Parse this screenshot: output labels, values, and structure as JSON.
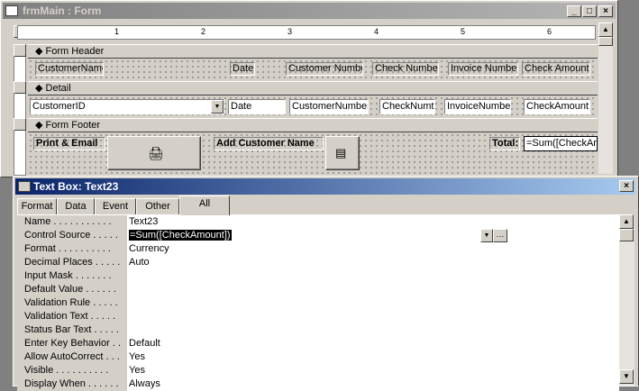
{
  "form_window": {
    "title": "frmMain : Form",
    "ruler_numbers": [
      "1",
      "2",
      "3",
      "4",
      "5",
      "6"
    ],
    "sections": {
      "header": "Form Header",
      "detail": "Detail",
      "footer": "Form Footer"
    },
    "header_labels": [
      "CustomerName",
      "Date",
      "Customer Number",
      "Check Number",
      "Invoice Number",
      "Check Amount"
    ],
    "detail_fields": {
      "customer_id": "CustomerID",
      "date": "Date",
      "customer_number": "CustomerNumber",
      "check_number": "CheckNumt",
      "invoice_number": "InvoiceNumbe",
      "check_amount": "CheckAmount"
    },
    "footer": {
      "print_label": "Print & Email",
      "add_customer_label": "Add Customer Name",
      "total_label": "Total:",
      "total_box": "=Sum([CheckAm"
    }
  },
  "property_window": {
    "title": "Text Box: Text23",
    "tabs": [
      "Format",
      "Data",
      "Event",
      "Other",
      "All"
    ],
    "active_tab": "All",
    "properties": [
      {
        "name": "Name . . . . . . . . . . .",
        "value": "Text23"
      },
      {
        "name": "Control Source . . . . .",
        "value": "=Sum([CheckAmount])"
      },
      {
        "name": "Format . . . . . . . . . .",
        "value": "Currency"
      },
      {
        "name": "Decimal Places . . . . .",
        "value": "Auto"
      },
      {
        "name": "Input Mask . . . . . . .",
        "value": ""
      },
      {
        "name": "Default Value . . . . . .",
        "value": ""
      },
      {
        "name": "Validation Rule . . . . .",
        "value": ""
      },
      {
        "name": "Validation Text . . . . .",
        "value": ""
      },
      {
        "name": "Status Bar Text . . . . .",
        "value": ""
      },
      {
        "name": "Enter Key Behavior . .",
        "value": "Default"
      },
      {
        "name": "Allow AutoCorrect . . .",
        "value": "Yes"
      },
      {
        "name": "Visible . . . . . . . . . .",
        "value": "Yes"
      },
      {
        "name": "Display When . . . . . .",
        "value": "Always"
      }
    ]
  },
  "colors": {
    "active_title": "#0a246a",
    "inactive_title": "#808080",
    "face": "#d4d0c8",
    "selection": "#000000"
  }
}
